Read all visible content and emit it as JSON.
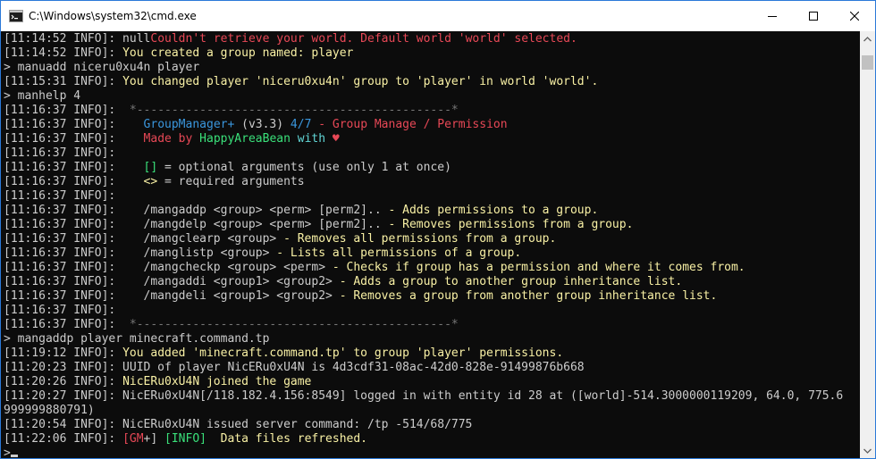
{
  "window": {
    "title": "C:\\Windows\\system32\\cmd.exe",
    "icons": {
      "app": "cmd-icon",
      "minimize": "minimize-icon",
      "maximize": "maximize-icon",
      "close": "close-icon"
    }
  },
  "console": {
    "lines": [
      [
        {
          "t": "[11:14:52 INFO]: null",
          "c": "gray"
        },
        {
          "t": "Couldn't retrieve your world. Default world 'world' selected.",
          "c": "red"
        }
      ],
      [
        {
          "t": "[11:14:52 INFO]: ",
          "c": "gray"
        },
        {
          "t": "You created a group named: player",
          "c": "yellow"
        }
      ],
      [
        {
          "t": "> manuadd niceru0xu4n player",
          "c": "gray"
        }
      ],
      [
        {
          "t": "[11:15:31 INFO]: ",
          "c": "gray"
        },
        {
          "t": "You changed player 'niceru0xu4n' group to 'player' in world 'world'.",
          "c": "yellow"
        }
      ],
      [
        {
          "t": "> manhelp 4",
          "c": "gray"
        }
      ],
      [
        {
          "t": "[11:16:37 INFO]:  ",
          "c": "gray"
        },
        {
          "t": "*---------------------------------------------*",
          "c": "dgray"
        }
      ],
      [
        {
          "t": "[11:16:37 INFO]:    ",
          "c": "gray"
        },
        {
          "t": "GroupManager+ ",
          "c": "teal"
        },
        {
          "t": "(v3.3) ",
          "c": "gray"
        },
        {
          "t": "4/7 ",
          "c": "teal"
        },
        {
          "t": "- Group Manage / Permission",
          "c": "red"
        }
      ],
      [
        {
          "t": "[11:16:37 INFO]:    ",
          "c": "gray"
        },
        {
          "t": "Made by ",
          "c": "red"
        },
        {
          "t": "HappyAreaBean ",
          "c": "lgreen"
        },
        {
          "t": "with ",
          "c": "cyan"
        },
        {
          "t": "♥",
          "c": "red"
        }
      ],
      [
        {
          "t": "[11:16:37 INFO]:",
          "c": "gray"
        }
      ],
      [
        {
          "t": "[11:16:37 INFO]:    ",
          "c": "gray"
        },
        {
          "t": "[] ",
          "c": "lgreen"
        },
        {
          "t": "= optional arguments (use only 1 at once)",
          "c": "gray"
        }
      ],
      [
        {
          "t": "[11:16:37 INFO]:    ",
          "c": "gray"
        },
        {
          "t": "<> ",
          "c": "yellow"
        },
        {
          "t": "= required arguments",
          "c": "gray"
        }
      ],
      [
        {
          "t": "[11:16:37 INFO]:",
          "c": "gray"
        }
      ],
      [
        {
          "t": "[11:16:37 INFO]:    /mangaddp <group> <perm> [perm2].. ",
          "c": "gray"
        },
        {
          "t": "- Adds permissions to a group.",
          "c": "yellow"
        }
      ],
      [
        {
          "t": "[11:16:37 INFO]:    /mangdelp <group> <perm> [perm2].. ",
          "c": "gray"
        },
        {
          "t": "- Removes permissions from a group.",
          "c": "yellow"
        }
      ],
      [
        {
          "t": "[11:16:37 INFO]:    /mangclearp <group> ",
          "c": "gray"
        },
        {
          "t": "- Removes all permissions from a group.",
          "c": "yellow"
        }
      ],
      [
        {
          "t": "[11:16:37 INFO]:    /manglistp <group> ",
          "c": "gray"
        },
        {
          "t": "- Lists all permissions of a group.",
          "c": "yellow"
        }
      ],
      [
        {
          "t": "[11:16:37 INFO]:    /mangcheckp <group> <perm> ",
          "c": "gray"
        },
        {
          "t": "- Checks if group has a permission and where it comes from.",
          "c": "yellow"
        }
      ],
      [
        {
          "t": "[11:16:37 INFO]:    /mangaddi <group1> <group2> ",
          "c": "gray"
        },
        {
          "t": "- Adds a group to another group inheritance list.",
          "c": "yellow"
        }
      ],
      [
        {
          "t": "[11:16:37 INFO]:    /mangdeli <group1> <group2> ",
          "c": "gray"
        },
        {
          "t": "- Removes a group from another group inheritance list.",
          "c": "yellow"
        }
      ],
      [
        {
          "t": "[11:16:37 INFO]:",
          "c": "gray"
        }
      ],
      [
        {
          "t": "[11:16:37 INFO]:  ",
          "c": "gray"
        },
        {
          "t": "*---------------------------------------------*",
          "c": "dgray"
        }
      ],
      [
        {
          "t": "> mangaddp player minecraft.command.tp",
          "c": "gray"
        }
      ],
      [
        {
          "t": "[11:19:12 INFO]: ",
          "c": "gray"
        },
        {
          "t": "You added 'minecraft.command.tp' to group 'player' permissions.",
          "c": "yellow"
        }
      ],
      [
        {
          "t": "[11:20:23 INFO]: UUID of player NicERu0xU4N is 4d3cdf31-08ac-42d0-828e-91499876b668",
          "c": "gray"
        }
      ],
      [
        {
          "t": "[11:20:26 INFO]: ",
          "c": "gray"
        },
        {
          "t": "NicERu0xU4N joined the game",
          "c": "yellow"
        }
      ],
      [
        {
          "t": "[11:20:27 INFO]: NicERu0xU4N[/118.182.4.156:8549] logged in with entity id 28 at ([world]-514.3000000119209, 64.0, 775.6",
          "c": "gray"
        }
      ],
      [
        {
          "t": "999999880791)",
          "c": "gray"
        }
      ],
      [
        {
          "t": "[11:20:54 INFO]: NicERu0xU4N issued server command: /tp -514/68/775",
          "c": "gray"
        }
      ],
      [
        {
          "t": "[11:22:06 INFO]: ",
          "c": "gray"
        },
        {
          "t": "[GM",
          "c": "red"
        },
        {
          "t": "+] ",
          "c": "gray"
        },
        {
          "t": "[INFO]",
          "c": "lgreen"
        },
        {
          "t": "  Data files refreshed.",
          "c": "yellow"
        }
      ],
      [
        {
          "t": ">",
          "c": "gray"
        }
      ]
    ],
    "prompt_line_index": 29
  },
  "colors": {
    "background": "#0c0c0c",
    "gray": "#cccccc",
    "red": "#e74856",
    "yellow": "#f9f1a5",
    "dgray": "#767676",
    "teal": "#3a96dd",
    "lgreen": "#3ae07a",
    "cyan": "#61d6d6",
    "border": "#2b79d8"
  }
}
